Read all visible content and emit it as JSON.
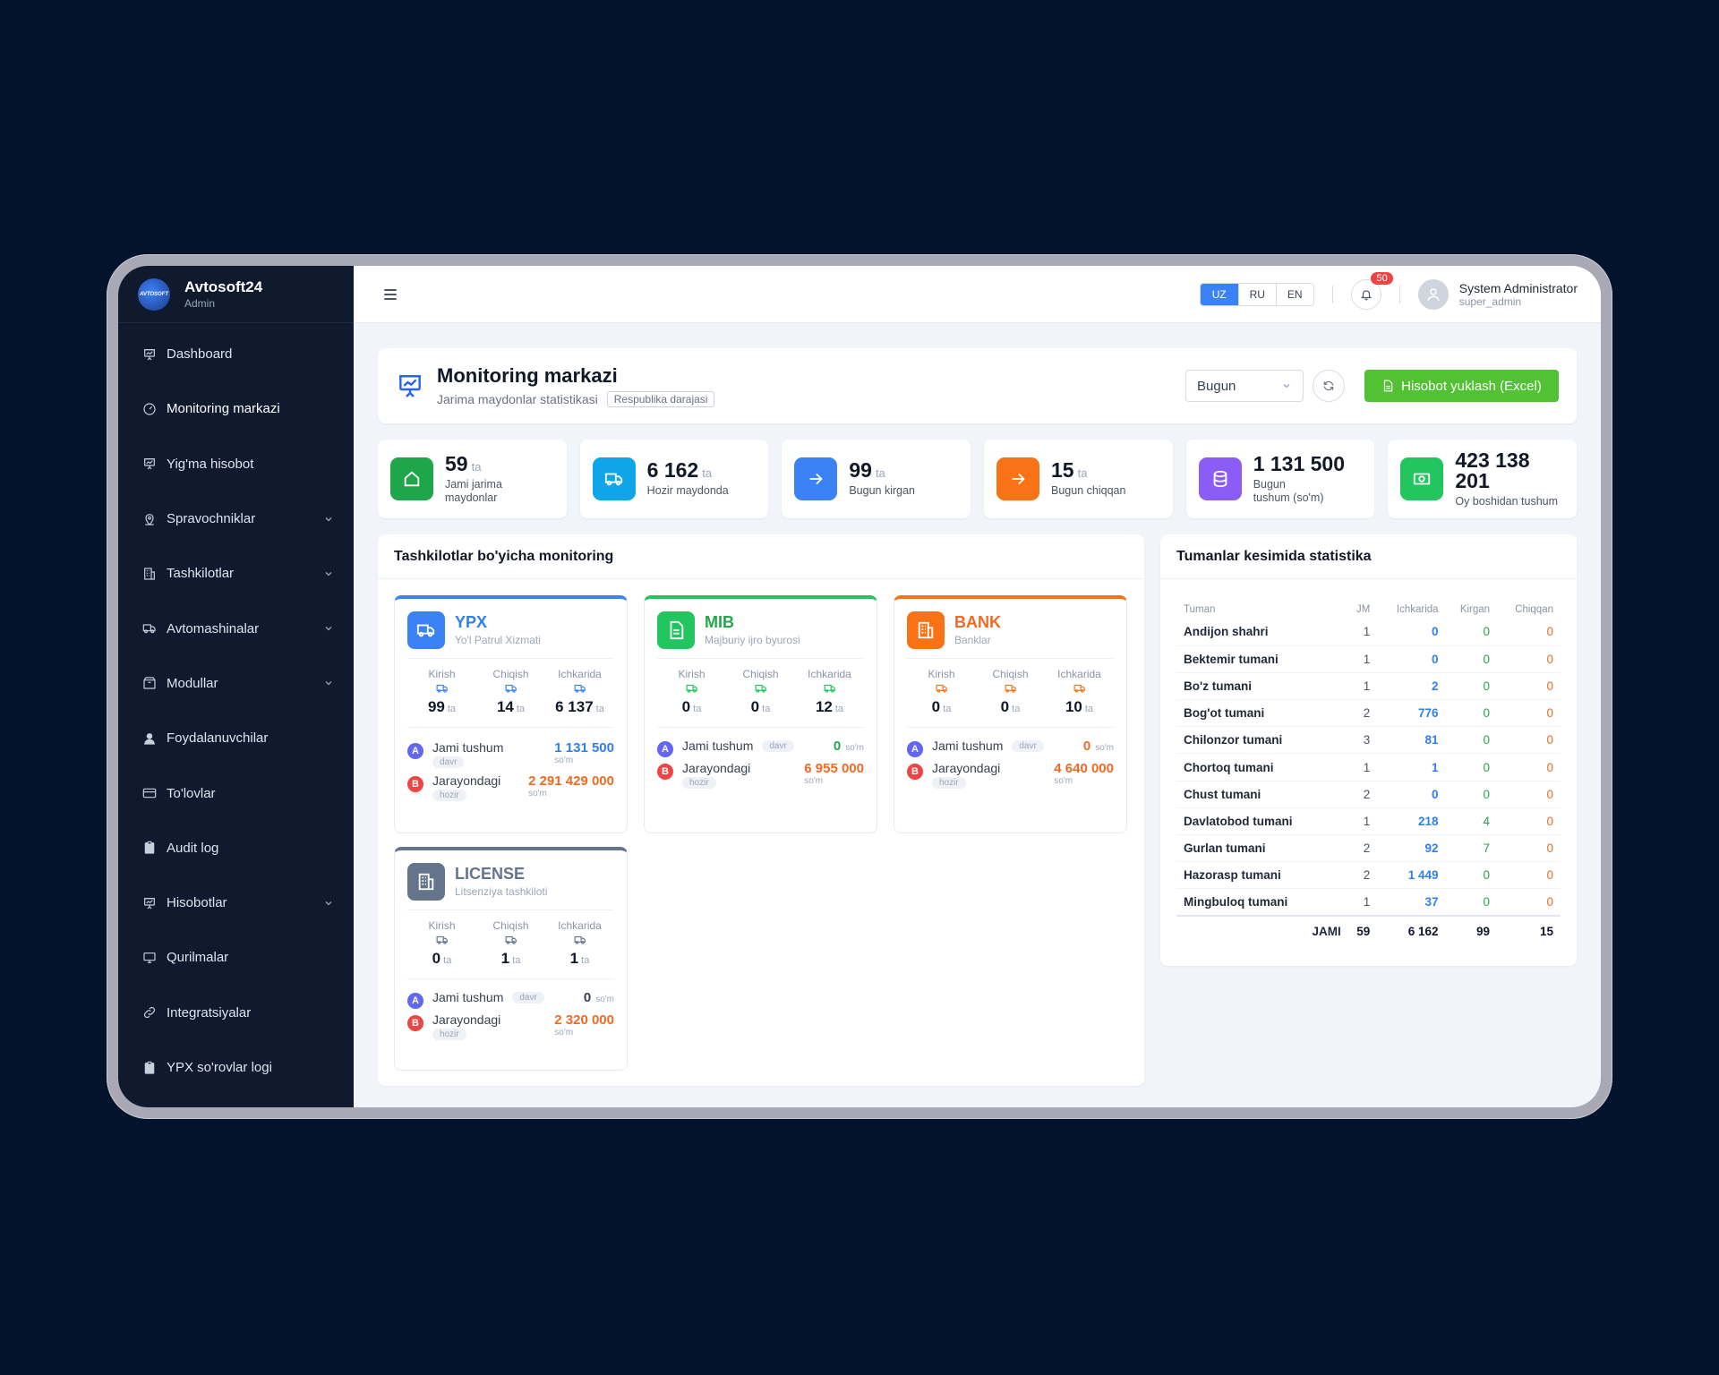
{
  "brand": {
    "name": "Avtosoft24",
    "role": "Admin",
    "logo_text": "AVTOSOFT"
  },
  "sidebar": {
    "items": [
      {
        "label": "Dashboard",
        "icon": "presentation-icon",
        "chevron": false
      },
      {
        "label": "Monitoring markazi",
        "icon": "gauge-icon",
        "chevron": false
      },
      {
        "label": "Yig'ma hisobot",
        "icon": "presentation-icon",
        "chevron": false
      },
      {
        "label": "Spravochniklar",
        "icon": "map-pin-icon",
        "chevron": true
      },
      {
        "label": "Tashkilotlar",
        "icon": "building-icon",
        "chevron": true
      },
      {
        "label": "Avtomashinalar",
        "icon": "truck-icon",
        "chevron": true
      },
      {
        "label": "Modullar",
        "icon": "box-icon",
        "chevron": true
      },
      {
        "label": "Foydalanuvchilar",
        "icon": "user-icon",
        "chevron": false
      },
      {
        "label": "To'lovlar",
        "icon": "credit-card-icon",
        "chevron": false
      },
      {
        "label": "Audit log",
        "icon": "clipboard-icon",
        "chevron": false
      },
      {
        "label": "Hisobotlar",
        "icon": "presentation-icon",
        "chevron": true
      },
      {
        "label": "Qurilmalar",
        "icon": "monitor-icon",
        "chevron": false
      },
      {
        "label": "Integratsiyalar",
        "icon": "link-icon",
        "chevron": false
      },
      {
        "label": "YPX so'rovlar logi",
        "icon": "clipboard-icon",
        "chevron": false
      }
    ]
  },
  "topbar": {
    "languages": [
      "UZ",
      "RU",
      "EN"
    ],
    "active_language": "UZ",
    "notifications": "50",
    "user_name": "System Administrator",
    "user_login": "super_admin"
  },
  "header": {
    "title": "Monitoring markazi",
    "subtitle": "Jarima maydonlar statistikasi",
    "level": "Respublika darajasi",
    "period": "Bugun",
    "export_label": "Hisobot yuklash (Excel)"
  },
  "stats": [
    {
      "value": "59",
      "unit": "ta",
      "label": "Jami jarima maydonlar",
      "color": "#1fa64a",
      "icon": "home-icon"
    },
    {
      "value": "6 162",
      "unit": "ta",
      "label": "Hozir maydonda",
      "color": "#0ea5e9",
      "icon": "truck-icon"
    },
    {
      "value": "99",
      "unit": "ta",
      "label": "Bugun kirgan",
      "color": "#3b82f6",
      "icon": "arrow-right-icon"
    },
    {
      "value": "15",
      "unit": "ta",
      "label": "Bugun chiqqan",
      "color": "#f97316",
      "icon": "arrow-right-icon"
    },
    {
      "value": "1 131 500",
      "unit": "",
      "label": "Bugun tushum (so'm)",
      "color": "#8b5cf6",
      "icon": "database-icon"
    },
    {
      "value": "423 138 201",
      "unit": "",
      "label": "Oy boshidan tushum",
      "color": "#22c55e",
      "icon": "cash-icon"
    }
  ],
  "orgs_section": {
    "title": "Tashkilotlar bo'yicha monitoring"
  },
  "org_labels": {
    "kirish": "Kirish",
    "chiqish": "Chiqish",
    "ichkarida": "Ichkarida",
    "unit": "ta",
    "jami": "Jami tushum",
    "davr": "davr",
    "jarayon": "Jarayondagi",
    "hozir": "hozir",
    "som": "so'm",
    "badge_a": "A",
    "badge_b": "B"
  },
  "orgs": [
    {
      "name": "YPX",
      "subtitle": "Yo'l Patrul Xizmati",
      "color": "#3b82f6",
      "name_color": "#2f7ff0",
      "icon": "truck-icon",
      "kirish": "99",
      "chiqish": "14",
      "ichkarida": "6 137",
      "jami": "1 131 500",
      "jami_color": "#2f80ed",
      "jarayon": "2 291 429 000",
      "jarayon_color": "#f26a22"
    },
    {
      "name": "MIB",
      "subtitle": "Majburiy ijro byurosi",
      "color": "#22c55e",
      "name_color": "#22a84a",
      "icon": "document-icon",
      "kirish": "0",
      "chiqish": "0",
      "ichkarida": "12",
      "jami": "0",
      "jami_color": "#22a84a",
      "jarayon": "6 955 000",
      "jarayon_color": "#f26a22"
    },
    {
      "name": "BANK",
      "subtitle": "Banklar",
      "color": "#f97316",
      "name_color": "#f26a22",
      "icon": "building-icon",
      "kirish": "0",
      "chiqish": "0",
      "ichkarida": "10",
      "jami": "0",
      "jami_color": "#f26a22",
      "jarayon": "4 640 000",
      "jarayon_color": "#f26a22"
    },
    {
      "name": "LICENSE",
      "subtitle": "Litsenziya tashkiloti",
      "color": "#64748b",
      "name_color": "#64748b",
      "icon": "building-icon",
      "kirish": "0",
      "chiqish": "1",
      "ichkarida": "1",
      "jami": "0",
      "jami_color": "#374151",
      "jarayon": "2 320 000",
      "jarayon_color": "#f26a22"
    }
  ],
  "districts": {
    "title": "Tumanlar kesimida statistika",
    "columns": [
      "Tuman",
      "JM",
      "Ichkarida",
      "Kirgan",
      "Chiqqan"
    ],
    "rows": [
      [
        "Andijon shahri",
        "1",
        "0",
        "0",
        "0"
      ],
      [
        "Bektemir tumani",
        "1",
        "0",
        "0",
        "0"
      ],
      [
        "Bo'z tumani",
        "1",
        "2",
        "0",
        "0"
      ],
      [
        "Bog'ot tumani",
        "2",
        "776",
        "0",
        "0"
      ],
      [
        "Chilonzor tumani",
        "3",
        "81",
        "0",
        "0"
      ],
      [
        "Chortoq tumani",
        "1",
        "1",
        "0",
        "0"
      ],
      [
        "Chust tumani",
        "2",
        "0",
        "0",
        "0"
      ],
      [
        "Davlatobod tumani",
        "1",
        "218",
        "4",
        "0"
      ],
      [
        "Gurlan tumani",
        "2",
        "92",
        "7",
        "0"
      ],
      [
        "Hazorasp tumani",
        "2",
        "1 449",
        "0",
        "0"
      ],
      [
        "Mingbuloq tumani",
        "1",
        "37",
        "0",
        "0"
      ]
    ],
    "total": [
      "JAMI",
      "59",
      "6 162",
      "99",
      "15"
    ]
  }
}
